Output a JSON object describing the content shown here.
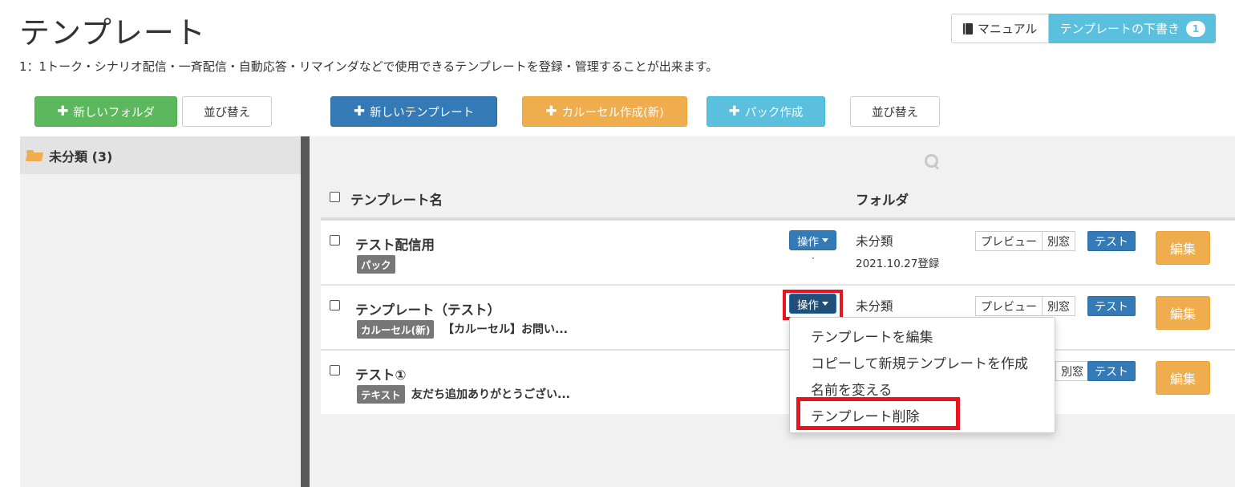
{
  "page": {
    "title": "テンプレート",
    "description": "1：1トーク・シナリオ配信・一斉配信・自動応答・リマインダなどで使用できるテンプレートを登録・管理することが出来ます。"
  },
  "top_actions": {
    "manual_label": "マニュアル",
    "draft_label": "テンプレートの下書き",
    "draft_count": "1"
  },
  "toolbar": {
    "new_folder": "新しいフォルダ",
    "sort_folders": "並び替え",
    "new_template": "新しいテンプレート",
    "carousel_create": "カルーセル作成(新)",
    "pack_create": "パック作成",
    "sort_templates": "並び替え"
  },
  "sidebar": {
    "items": [
      {
        "label": "未分類 (3)"
      }
    ]
  },
  "table": {
    "headers": {
      "name": "テンプレート名",
      "folder": "フォルダ"
    },
    "rows": [
      {
        "name": "テスト配信用",
        "tag": "パック",
        "preview": "",
        "op": "操作",
        "dot": "·",
        "folder": "未分類",
        "date": "2021.10.27登録",
        "preview_btn": "プレビュー",
        "window_btn": "別窓",
        "test_btn": "テスト",
        "edit_btn": "編集"
      },
      {
        "name": "テンプレート（テスト）",
        "tag": "カルーセル(新)",
        "preview": "【カルーセル】お問い...",
        "op": "操作",
        "folder": "未分類",
        "preview_btn": "プレビュー",
        "window_btn": "別窓",
        "test_btn": "テスト",
        "edit_btn": "編集"
      },
      {
        "name": "テスト①",
        "tag": "テキスト",
        "preview": "友だち追加ありがとうござい...",
        "window_btn": "別窓",
        "test_btn": "テスト",
        "edit_btn": "編集"
      }
    ]
  },
  "dropdown": {
    "items": [
      "テンプレートを編集",
      "コピーして新規テンプレートを作成",
      "名前を変える",
      "テンプレート削除"
    ]
  },
  "colors": {
    "primary": "#337ab7",
    "success": "#5cb85c",
    "warning": "#f0ad4e",
    "info": "#5bc0de",
    "highlight": "#e8141f"
  }
}
